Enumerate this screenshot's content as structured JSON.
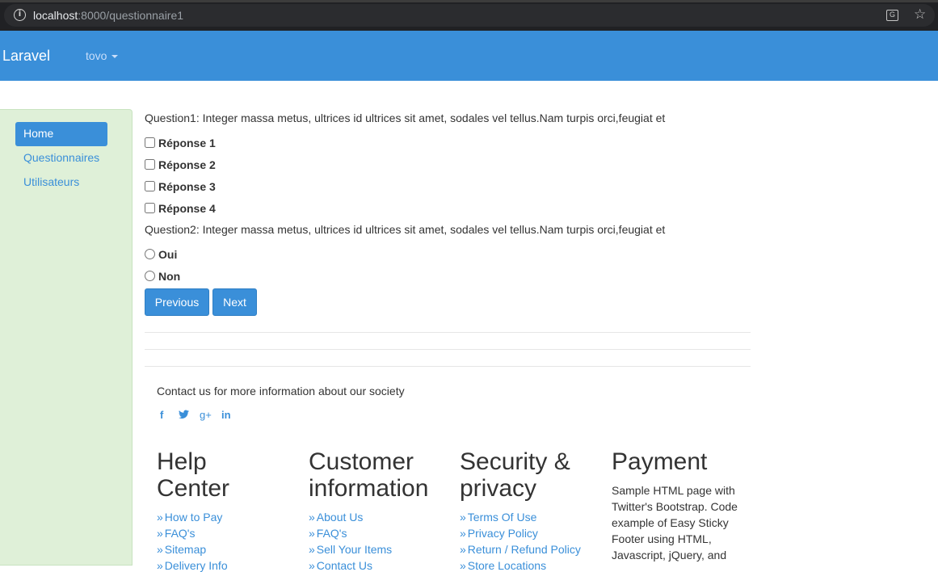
{
  "browser": {
    "url_host": "localhost",
    "url_path": ":8000/questionnaire1"
  },
  "navbar": {
    "brand": "Laravel",
    "user": "tovo"
  },
  "sidebar": {
    "items": [
      {
        "label": "Home",
        "active": true
      },
      {
        "label": "Questionnaires",
        "active": false
      },
      {
        "label": "Utilisateurs",
        "active": false
      }
    ]
  },
  "questions": [
    {
      "text": "Question1: Integer massa metus, ultrices id ultrices sit amet, sodales vel tellus.Nam turpis orci,feugiat et",
      "type": "checkbox",
      "options": [
        "Réponse 1",
        "Réponse 2",
        "Réponse 3",
        "Réponse 4"
      ]
    },
    {
      "text": "Question2: Integer massa metus, ultrices id ultrices sit amet, sodales vel tellus.Nam turpis orci,feugiat et",
      "type": "radio",
      "options": [
        "Oui",
        "Non"
      ]
    }
  ],
  "buttons": {
    "previous": "Previous",
    "next": "Next"
  },
  "footer": {
    "contact": "Contact us for more information about our society",
    "social": [
      "facebook-icon",
      "twitter-icon",
      "google-plus-icon",
      "linkedin-icon"
    ],
    "columns": [
      {
        "title": "Help Center",
        "links": [
          "How to Pay",
          "FAQ's",
          "Sitemap",
          "Delivery Info"
        ]
      },
      {
        "title": "Customer information",
        "links": [
          "About Us",
          "FAQ's",
          "Sell Your Items",
          "Contact Us"
        ]
      },
      {
        "title": "Security & privacy",
        "links": [
          "Terms Of Use",
          "Privacy Policy",
          "Return / Refund Policy",
          "Store Locations"
        ]
      },
      {
        "title": "Payment",
        "text": "Sample HTML page with Twitter's Bootstrap. Code example of Easy Sticky Footer using HTML, Javascript, jQuery, and"
      }
    ]
  },
  "colors": {
    "primary": "#3a8fd9",
    "sidebar_bg": "#dff0d8",
    "browser_bg": "#202124"
  }
}
